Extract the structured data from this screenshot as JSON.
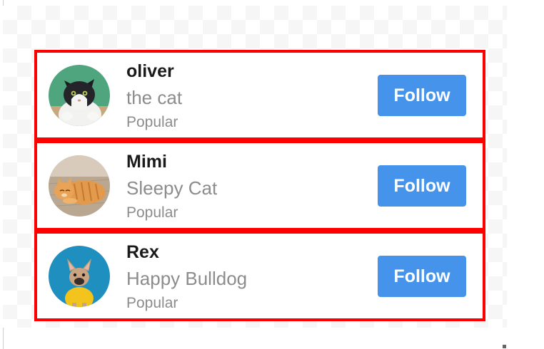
{
  "profiles": [
    {
      "name": "oliver",
      "tagline": "the cat",
      "badge": "Popular",
      "follow_label": "Follow",
      "avatar_icon": "black-white-cat-photo"
    },
    {
      "name": "Mimi",
      "tagline": "Sleepy Cat",
      "badge": "Popular",
      "follow_label": "Follow",
      "avatar_icon": "orange-tabby-cat-photo"
    },
    {
      "name": "Rex",
      "tagline": "Happy Bulldog",
      "badge": "Popular",
      "follow_label": "Follow",
      "avatar_icon": "french-bulldog-photo"
    }
  ],
  "colors": {
    "card_border": "#ff0000",
    "button_bg": "#4693ec",
    "button_text": "#ffffff",
    "name_text": "#1a1a1a",
    "muted_text": "#8c8c8c"
  }
}
